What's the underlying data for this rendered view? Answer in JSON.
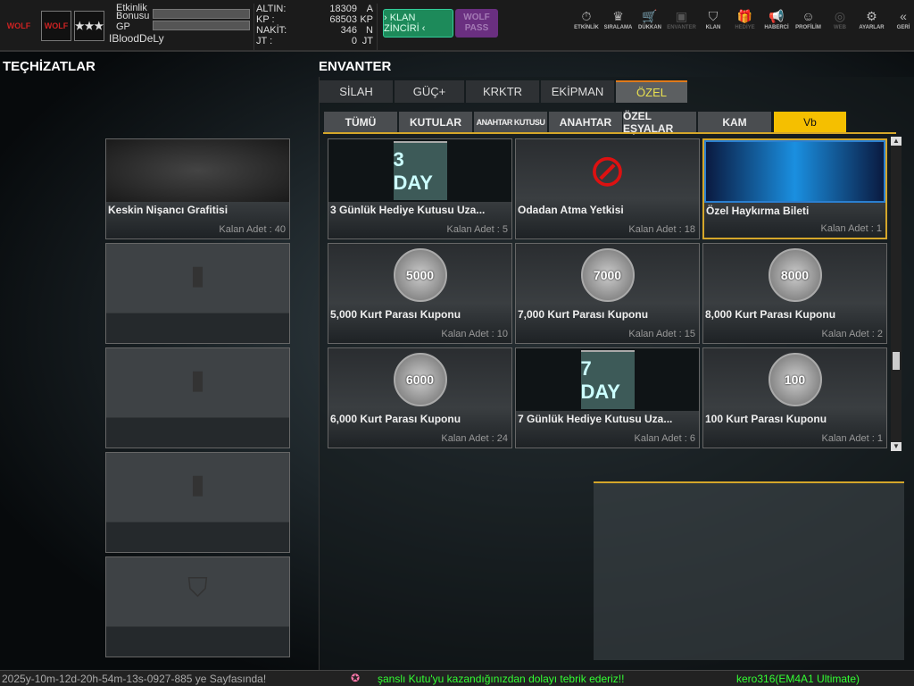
{
  "topbar": {
    "logo_text": "WOLF",
    "bonus_label": "Etkinlik Bonusu",
    "gp_label": "GP",
    "username": "IBloodDeLy",
    "currencies": [
      {
        "label": "ALTIN:",
        "value": "18309",
        "unit": "A"
      },
      {
        "label": "KP :",
        "value": "68503",
        "unit": "KP"
      },
      {
        "label": "NAKİT:",
        "value": "346",
        "unit": "N"
      },
      {
        "label": "JT :",
        "value": "0",
        "unit": "JT"
      }
    ],
    "klan_button": "› KLAN ZİNCİRİ ‹",
    "wolf_pass": "WOLF PASS",
    "nav": [
      {
        "label": "ETKİNLİK",
        "icon": "⏱"
      },
      {
        "label": "SIRALAMA",
        "icon": "♛"
      },
      {
        "label": "DÜKKAN",
        "icon": "🛒"
      },
      {
        "label": "ENVANTER",
        "icon": "▣"
      },
      {
        "label": "KLAN",
        "icon": "⛉"
      },
      {
        "label": "HEDİYE",
        "icon": "🎁"
      },
      {
        "label": "HABERCİ",
        "icon": "📢"
      },
      {
        "label": "PROFİLİM",
        "icon": "☺"
      },
      {
        "label": "WEB",
        "icon": "◎"
      },
      {
        "label": "AYARLAR",
        "icon": "⚙"
      },
      {
        "label": "GERİ",
        "icon": "«"
      }
    ]
  },
  "left": {
    "title": "TEÇHİZATLAR",
    "cards": [
      {
        "name": "Keskin Nişancı Grafitisi",
        "count": "Kalan Adet : 40"
      }
    ]
  },
  "inventory": {
    "title": "ENVANTER",
    "tabs": [
      "SİLAH",
      "GÜÇ+",
      "KRKTR",
      "EKİPMAN",
      "ÖZEL"
    ],
    "subtabs": [
      "TÜMÜ",
      "KUTULAR",
      "ANAHTAR KUTUSU",
      "ANAHTAR",
      "ÖZEL EŞYALAR",
      "KAM",
      "Vb"
    ],
    "items": [
      {
        "name": "3 Günlük Hediye Kutusu Uza...",
        "count": "Kalan Adet : 5",
        "badge": "3 DAY"
      },
      {
        "name": "Odadan Atma Yetkisi",
        "count": "Kalan Adet : 18",
        "badge": ""
      },
      {
        "name": "Özel Haykırma Bileti",
        "count": "Kalan Adet : 1",
        "badge": ""
      },
      {
        "name": "5,000 Kurt Parası Kuponu",
        "count": "Kalan Adet : 10",
        "badge": "5000"
      },
      {
        "name": "7,000 Kurt Parası Kuponu",
        "count": "Kalan Adet : 15",
        "badge": "7000"
      },
      {
        "name": "8,000 Kurt Parası Kuponu",
        "count": "Kalan Adet : 2",
        "badge": "8000"
      },
      {
        "name": "6,000 Kurt Parası Kuponu",
        "count": "Kalan Adet : 24",
        "badge": "6000"
      },
      {
        "name": "7 Günlük Hediye Kutusu Uza...",
        "count": "Kalan Adet : 6",
        "badge": "7 DAY"
      },
      {
        "name": "100 Kurt Parası Kuponu",
        "count": "Kalan Adet : 1",
        "badge": "100"
      }
    ]
  },
  "status": {
    "left": "2025y-10m-12d-20h-54m-13s-0927-885 ye Sayfasında!",
    "message": "şanslı Kutu'yu kazandığınızdan dolayı tebrik ederiz!!",
    "player": "kero316(EM4A1 Ultimate)"
  }
}
